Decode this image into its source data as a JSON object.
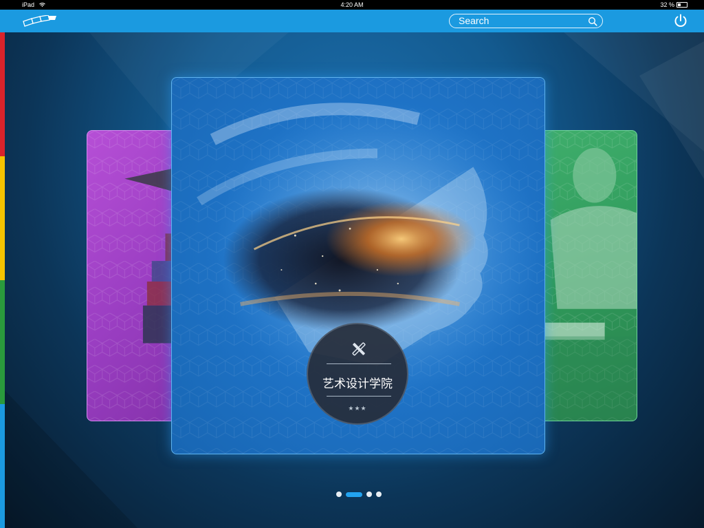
{
  "status_bar": {
    "device": "iPad",
    "time": "4:20 AM",
    "battery": "32 %",
    "battery_level": 0.32
  },
  "nav": {
    "search_placeholder": "Search"
  },
  "carousel": {
    "cards": [
      {
        "id": "left",
        "color": "#a646cc"
      },
      {
        "id": "main",
        "title": "艺术设计学院",
        "stars": "★★★",
        "color": "#1f74c8"
      },
      {
        "id": "right",
        "color": "#32a060"
      }
    ],
    "pages": 4,
    "active_page": 2
  },
  "side_strip_colors": [
    "#d9232b",
    "#f5c300",
    "#2a9a3c",
    "#1b9ae0"
  ],
  "accent_color": "#1b9ae0"
}
